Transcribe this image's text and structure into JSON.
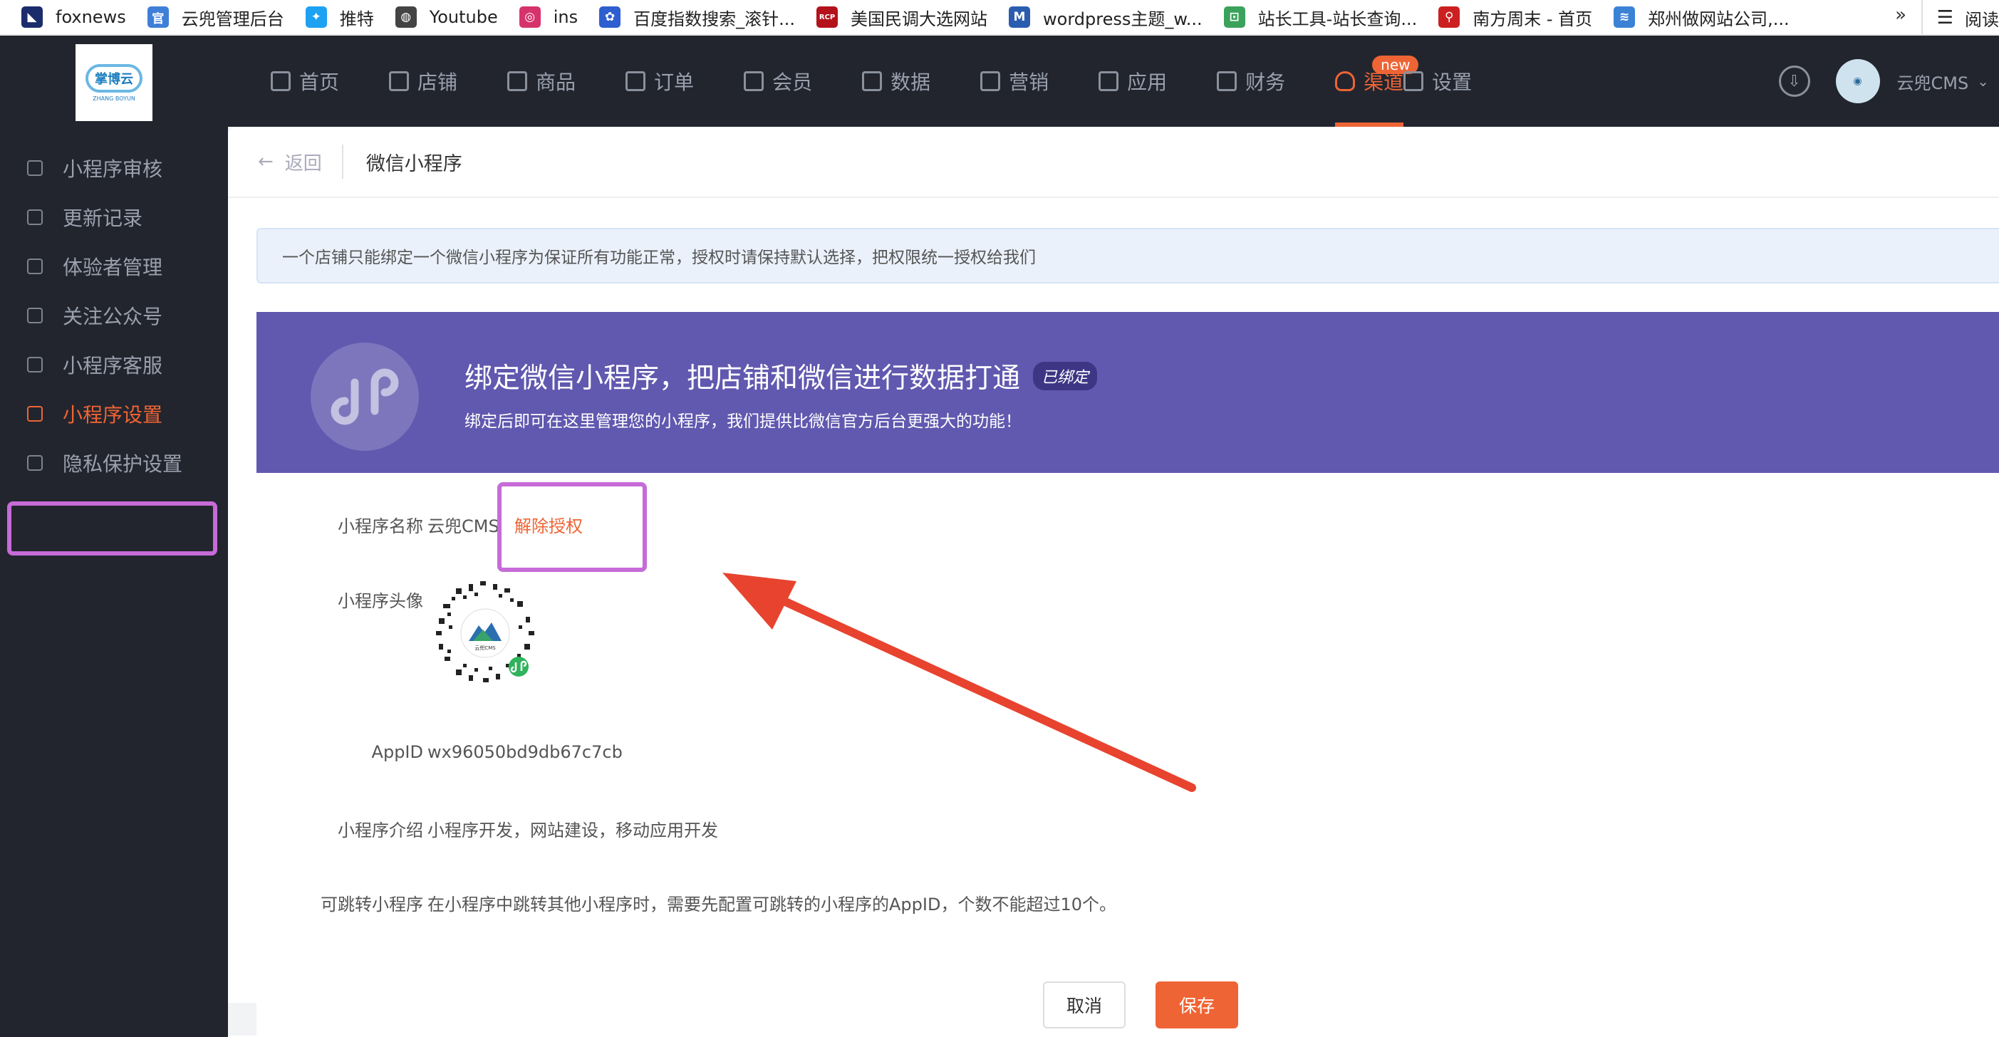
{
  "bookmarks": [
    {
      "label": "foxnews",
      "icon": "foxnews-icon",
      "color": "#1a2c6b",
      "glyph": "◣"
    },
    {
      "label": "云兜管理后台",
      "icon": "admin-icon",
      "color": "#3f7fd8",
      "glyph": "官"
    },
    {
      "label": "推特",
      "icon": "twitter-icon",
      "color": "#1da1f2",
      "glyph": "✦"
    },
    {
      "label": "Youtube",
      "icon": "globe-icon",
      "color": "#444444",
      "glyph": "◍"
    },
    {
      "label": "ins",
      "icon": "instagram-icon",
      "color": "#d6336c",
      "glyph": "◎"
    },
    {
      "label": "百度指数搜索_滚针...",
      "icon": "baidu-icon",
      "color": "#2e5fd0",
      "glyph": "✿"
    },
    {
      "label": "美国民调大选网站",
      "icon": "rcp-icon",
      "color": "#b3121b",
      "glyph": "RCP"
    },
    {
      "label": "wordpress主题_w...",
      "icon": "wordpress-icon",
      "color": "#2a5db0",
      "glyph": "M"
    },
    {
      "label": "站长工具-站长查询...",
      "icon": "tools-icon",
      "color": "#3aa25a",
      "glyph": "⊡"
    },
    {
      "label": "南方周末 - 首页",
      "icon": "pin-icon",
      "color": "#cc2020",
      "glyph": "⚲"
    },
    {
      "label": "郑州做网站公司,...",
      "icon": "stack-icon",
      "color": "#3b82d6",
      "glyph": "≋"
    }
  ],
  "bookmarks_more": "»",
  "reading_list": "阅读",
  "logo": {
    "cn": "掌博云",
    "en": "ZHANG BOYUN"
  },
  "nav": [
    {
      "label": "首页",
      "icon": "home-icon"
    },
    {
      "label": "店铺",
      "icon": "store-icon"
    },
    {
      "label": "商品",
      "icon": "goods-icon"
    },
    {
      "label": "订单",
      "icon": "order-icon"
    },
    {
      "label": "会员",
      "icon": "member-icon"
    },
    {
      "label": "数据",
      "icon": "data-icon"
    },
    {
      "label": "营销",
      "icon": "tag-icon"
    },
    {
      "label": "应用",
      "icon": "app-icon"
    },
    {
      "label": "财务",
      "icon": "finance-icon"
    },
    {
      "label": "渠道",
      "icon": "channel-icon",
      "badge": "new",
      "active": true
    },
    {
      "label": "设置",
      "icon": "gear-icon"
    }
  ],
  "user": {
    "name": "云兜CMS"
  },
  "sidebar": [
    {
      "label": "小程序审核",
      "icon": "link-icon"
    },
    {
      "label": "更新记录",
      "icon": "record-icon"
    },
    {
      "label": "体验者管理",
      "icon": "user-icon"
    },
    {
      "label": "关注公众号",
      "icon": "wechat-icon"
    },
    {
      "label": "小程序客服",
      "icon": "chat-icon"
    },
    {
      "label": "小程序设置",
      "icon": "settings-doc-icon",
      "active": true
    },
    {
      "label": "隐私保护设置",
      "icon": "privacy-icon"
    }
  ],
  "page": {
    "back": "返回",
    "title": "微信小程序"
  },
  "notice": "一个店铺只能绑定一个微信小程序为保证所有功能正常，授权时请保持默认选择，把权限统一授权给我们",
  "banner": {
    "title": "绑定微信小程序，把店铺和微信进行数据打通",
    "tag": "已绑定",
    "subtitle": "绑定后即可在这里管理您的小程序，我们提供比微信官方后台更强大的功能！"
  },
  "form": {
    "name_label": "小程序名称",
    "name_value": "云兜CMS",
    "unbind": "解除授权",
    "avatar_label": "小程序头像",
    "qr_text": "云兜CMS",
    "appid_label": "AppID",
    "appid_value": "wx96050bd9db67c7cb",
    "intro_label": "小程序介绍",
    "intro_value": "小程序开发，网站建设，移动应用开发",
    "jump_label": "可跳转小程序",
    "jump_value": "在小程序中跳转其他小程序时，需要先配置可跳转的小程序的AppID，个数不能超过10个。"
  },
  "buttons": {
    "cancel": "取消",
    "save": "保存"
  },
  "colors": {
    "accent": "#ee6435",
    "banner": "#6158af",
    "highlight": "#c66bd8",
    "arrow": "#e8432f"
  }
}
